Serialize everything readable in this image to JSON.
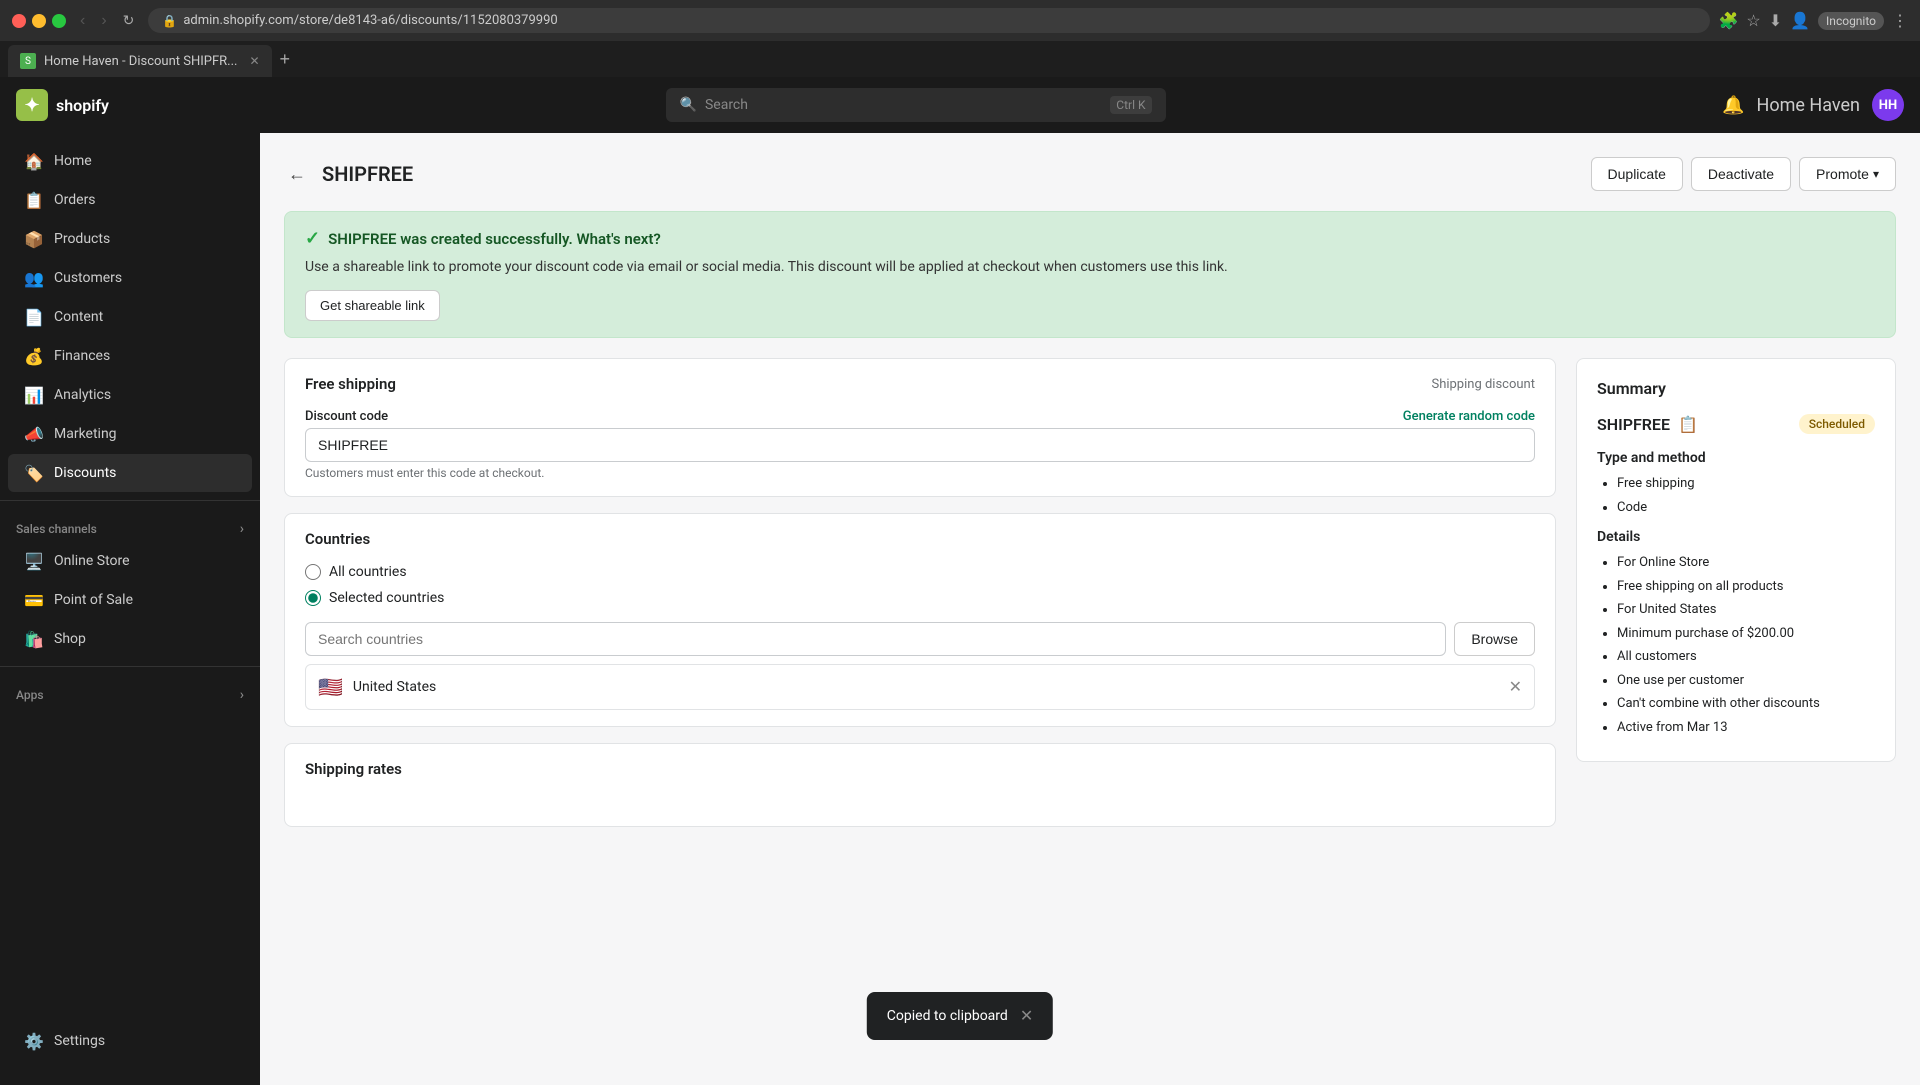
{
  "browser": {
    "address": "admin.shopify.com/store/de8143-a6/discounts/1152080379990",
    "tab_title": "Home Haven - Discount SHIPFR...",
    "incognito_label": "Incognito"
  },
  "shopify_header": {
    "logo_text": "shopify",
    "search_placeholder": "Search",
    "search_shortcut": "Ctrl K",
    "store_name": "Home Haven",
    "avatar_initials": "HH"
  },
  "sidebar": {
    "items": [
      {
        "id": "home",
        "label": "Home",
        "icon": "🏠"
      },
      {
        "id": "orders",
        "label": "Orders",
        "icon": "📋"
      },
      {
        "id": "products",
        "label": "Products",
        "icon": "📦"
      },
      {
        "id": "customers",
        "label": "Customers",
        "icon": "👥"
      },
      {
        "id": "content",
        "label": "Content",
        "icon": "📄"
      },
      {
        "id": "finances",
        "label": "Finances",
        "icon": "💰"
      },
      {
        "id": "analytics",
        "label": "Analytics",
        "icon": "📊"
      },
      {
        "id": "marketing",
        "label": "Marketing",
        "icon": "📣"
      },
      {
        "id": "discounts",
        "label": "Discounts",
        "icon": "🏷️",
        "active": true
      }
    ],
    "sales_channels_label": "Sales channels",
    "sales_channels": [
      {
        "id": "online-store",
        "label": "Online Store",
        "icon": "🖥️"
      },
      {
        "id": "point-of-sale",
        "label": "Point of Sale",
        "icon": "💳"
      },
      {
        "id": "shop",
        "label": "Shop",
        "icon": "🛍️"
      }
    ],
    "apps_label": "Apps",
    "settings_label": "Settings",
    "settings_icon": "⚙️"
  },
  "page": {
    "title": "SHIPFREE",
    "back_label": "←",
    "duplicate_btn": "Duplicate",
    "deactivate_btn": "Deactivate",
    "promote_btn": "Promote"
  },
  "success_banner": {
    "title": "SHIPFREE was created successfully. What's next?",
    "text": "Use a shareable link to promote your discount code via email or social media. This discount will be applied at checkout when customers use this link.",
    "link_btn": "Get shareable link"
  },
  "discount_form": {
    "type_label": "Free shipping",
    "type_subtitle": "Shipping discount",
    "code_label": "Discount code",
    "generate_link": "Generate random code",
    "code_value": "SHIPFREE",
    "code_hint": "Customers must enter this code at checkout.",
    "countries_title": "Countries",
    "all_countries_label": "All countries",
    "selected_countries_label": "Selected countries",
    "search_countries_placeholder": "Search countries",
    "browse_btn": "Browse",
    "selected_country": "United States",
    "country_flag": "🇺🇸",
    "shipping_rates_title": "Shipping rates"
  },
  "summary": {
    "title": "Summary",
    "code": "SHIPFREE",
    "status_badge": "Scheduled",
    "type_method_title": "Type and method",
    "type_item1": "Free shipping",
    "type_item2": "Code",
    "details_title": "Details",
    "details": [
      "For Online Store",
      "Free shipping on all products",
      "For United States",
      "Minimum purchase of $200.00",
      "All customers",
      "One use per customer",
      "Can't combine with other discounts",
      "Active from Mar 13"
    ]
  },
  "toast": {
    "message": "Copied to clipboard",
    "close_icon": "✕"
  }
}
